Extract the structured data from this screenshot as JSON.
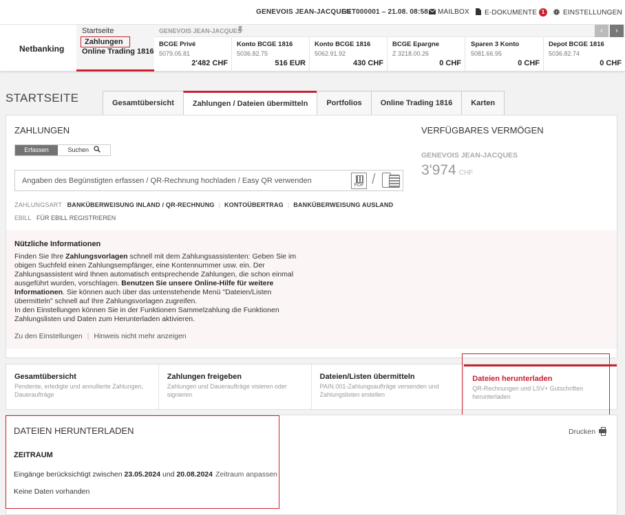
{
  "header": {
    "user": "GENEVOIS JEAN-JACQUES",
    "contract": "GET000001  – 21.08. 08:58",
    "mailbox": "MAILBOX",
    "edocs": "E-DOKUMENTE",
    "edocs_count": "1",
    "settings": "EINSTELLUNGEN"
  },
  "brand": "Netbanking",
  "nav": {
    "start": "Startseite",
    "payments": "Zahlungen",
    "trading": "Online Trading 1816"
  },
  "accounts_bar": {
    "owner": "GENEVOIS JEAN-JACQUES",
    "prev": "‹",
    "next": "›",
    "items": [
      {
        "name": "BCGE Privé",
        "number": "5079.05.81",
        "balance": "2'482 CHF"
      },
      {
        "name": "Konto BCGE 1816",
        "number": "5036.82.75",
        "balance": "516 EUR"
      },
      {
        "name": "Konto BCGE 1816",
        "number": "5062.91.92",
        "balance": "430 CHF"
      },
      {
        "name": "BCGE Epargne",
        "number": "Z 3218.00.26",
        "balance": "0 CHF"
      },
      {
        "name": "Sparen 3 Konto",
        "number": "5081.66.95",
        "balance": "0 CHF"
      },
      {
        "name": "Depot BCGE 1816",
        "number": "5036.82.74",
        "balance": "0 CHF"
      }
    ]
  },
  "page_title": "STARTSEITE",
  "tabs": [
    {
      "label": "Gesamtübersicht"
    },
    {
      "label": "Zahlungen / Dateien übermitteln"
    },
    {
      "label": "Portfolios"
    },
    {
      "label": "Online Trading 1816"
    },
    {
      "label": "Karten"
    }
  ],
  "payments": {
    "title": "ZAHLUNGEN",
    "seg_capture": "Erfassen",
    "seg_search": "Suchen",
    "search_placeholder": "Angaben des Begünstigten erfassen / QR-Rechnung hochladen / Easy QR verwenden",
    "pdf_label": "PDF",
    "slash": "/",
    "paytype_label": "ZAHLUNGSART",
    "paytypes": [
      "BANKÜBERWEISUNG INLAND / QR-RECHNUNG",
      "KONTOÜBERTRAG",
      "BANKÜBERWEISUNG AUSLAND"
    ],
    "ebill_label": "EBILL",
    "ebill_link": "FÜR EBILL REGISTRIEREN"
  },
  "info": {
    "title": "Nützliche Informationen",
    "t1": "Finden Sie Ihre ",
    "t2": "Zahlungsvorlagen",
    "t3": " schnell mit dem Zahlungsassistenten: Geben Sie im obigen Suchfeld einen Zahlungsempfänger, eine Kontennummer usw. ein. Der Zahlungsassistent wird Ihnen automatisch entsprechende Zahlungen, die schon einmal ausgeführt wurden, vorschlagen. ",
    "t4": "Benutzen Sie unsere Online-Hilfe für weitere Informationen",
    "t5": ". Sie können auch über das untenstehende Menü \"Dateien/Listen übermitteln\" schnell auf Ihre Zahlungsvorlagen zugreifen.",
    "t6": "In den Einstellungen können Sie in der Funktionen Sammelzahlung die Funktionen Zahlungslisten und Daten zum Herunterladen aktivieren.",
    "link_settings": "Zu den Einstellungen",
    "link_sep": "|",
    "link_hide": "Hinweis nicht mehr anzeigen"
  },
  "assets": {
    "title": "VERFÜGBARES VERMÖGEN",
    "owner": "GENEVOIS JEAN-JACQUES",
    "amount": "3'974",
    "currency": "CHF"
  },
  "cards": [
    {
      "title": "Gesamtübersicht",
      "desc": "Pendente, erledigte und annullierte Zahlungen, Daueraufträge"
    },
    {
      "title": "Zahlungen freigeben",
      "desc": "Zahlungen und Daueraufträge visieren oder signieren"
    },
    {
      "title": "Dateien/Listen übermitteln",
      "desc": "PAIN.001-Zahlungsaufträge versenden und Zahlungslisten erstellen"
    },
    {
      "title": "Dateien herunterladen",
      "desc": "QR-Rechnungen und LSV+ Gutschriften herunterladen"
    }
  ],
  "downloads": {
    "title": "DATEIEN HERUNTERLADEN",
    "print": "Drucken",
    "period_title": "ZEITRAUM",
    "range_prefix": "Eingänge berücksichtigt zwischen ",
    "date_from": "23.05.2024",
    "range_and": " und ",
    "date_to": "20.08.2024",
    "adjust": "Zeitraum anpassen",
    "nodata": "Keine Daten vorhanden"
  },
  "icons": {
    "mail": "envelope-icon",
    "edocs": "document-icon",
    "settings": "gear-icon",
    "search": "magnifier-icon",
    "print": "printer-icon",
    "pin": "pin-icon"
  },
  "colors": {
    "accent": "#c8202f",
    "segment_active": "#737373"
  }
}
